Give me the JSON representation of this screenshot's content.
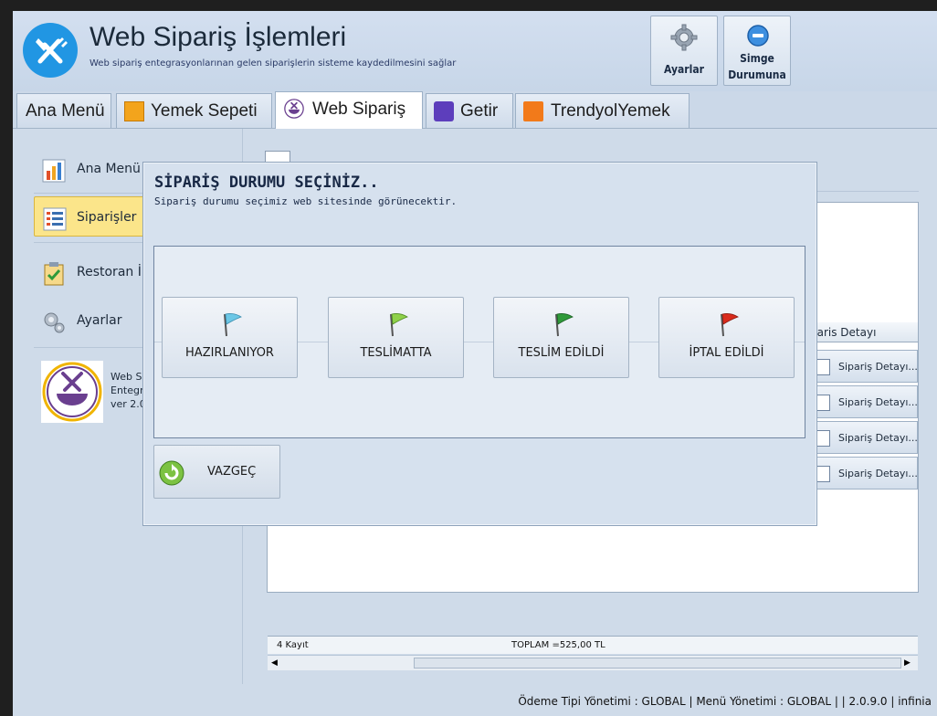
{
  "header": {
    "title": "Web Sipariş İşlemleri",
    "subtitle": "Web sipariş entegrasyonlarınan gelen siparişlerin sisteme kaydedilmesini sağlar",
    "settings_label": "Ayarlar",
    "minimize_label_1": "Simge",
    "minimize_label_2": "Durumuna"
  },
  "tabs": [
    {
      "label": "Ana Menü",
      "icon": "none"
    },
    {
      "label": "Yemek Sepeti",
      "icon": "yemeksepeti-icon"
    },
    {
      "label": "Web Sipariş",
      "icon": "web-order-icon"
    },
    {
      "label": "Getir",
      "icon": "getir-icon"
    },
    {
      "label": "TrendyolYemek",
      "icon": "trendyol-icon"
    }
  ],
  "sidebar": {
    "items": [
      {
        "label": "Ana Menü",
        "icon": "bar-chart-icon"
      },
      {
        "label": "Siparişler",
        "icon": "list-icon"
      },
      {
        "label": "Restoran İ",
        "icon": "clipboard-check-icon"
      },
      {
        "label": "Ayarlar",
        "icon": "gears-icon"
      }
    ],
    "info_1": "Web Si",
    "info_2": "Entegr",
    "info_3": "ver 2.0"
  },
  "grid": {
    "header_col": "paris Detayı",
    "detail_button": "Sipariş Detayı...",
    "record_count": "4 Kayıt",
    "total": "TOPLAM =525,00 TL"
  },
  "dialog": {
    "title": "SİPARİŞ DURUMU SEÇİNİZ..",
    "subtitle": "Sipariş durumu seçimiz web sitesinde görünecektir.",
    "buttons": [
      {
        "label": "HAZIRLANIYOR",
        "color": "#6cc7e6"
      },
      {
        "label": "TESLİMATTA",
        "color": "#8fd14a"
      },
      {
        "label": "TESLİM EDİLDİ",
        "color": "#2f9a3a"
      },
      {
        "label": "İPTAL EDİLDİ",
        "color": "#d92b1c"
      }
    ],
    "cancel": "VAZGEÇ"
  },
  "status": "Ödeme Tipi Yönetimi : GLOBAL  | Menü Yönetimi : GLOBAL  |  | 2.0.9.0  | infinia"
}
